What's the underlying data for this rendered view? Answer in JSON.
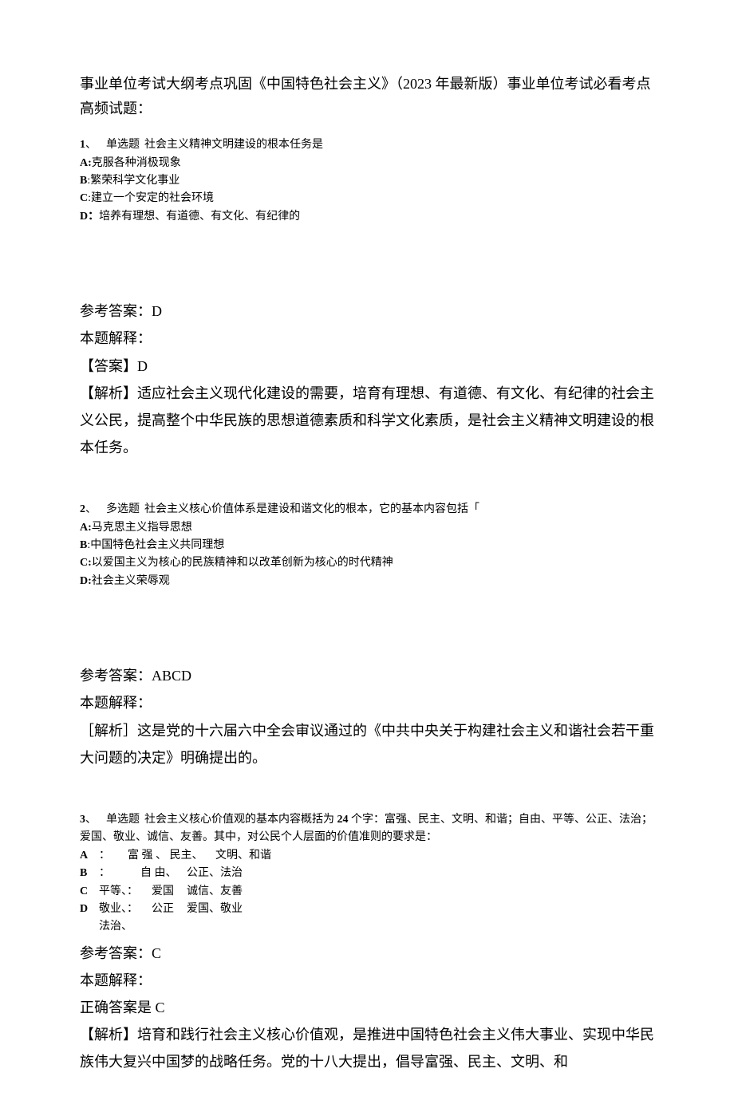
{
  "title": "事业单位考试大纲考点巩固《中国特色社会主义》（2023 年最新版）事业单位考试必看考点高频试题：",
  "q1": {
    "num": "1",
    "type": "单选题",
    "stem": "社会主义精神文明建设的根本任务是",
    "A_label": "A:",
    "A_text": "克服各种消极现象",
    "B_label": "B",
    "B_text": ":繁荣科学文化事业",
    "C_label": "C",
    "C_text": ":建立一个安定的社会环境",
    "D_label": "D：",
    "D_text": "培养有理想、有道德、有文化、有纪律的",
    "ref_answer_label": "参考答案：",
    "ref_answer": "D",
    "expl_label": "本题解释：",
    "ans_label": "【答案】",
    "ans": "D",
    "explain": "【解析】适应社会主义现代化建设的需要，培育有理想、有道德、有文化、有纪律的社会主义公民，提高整个中华民族的思想道德素质和科学文化素质，是社会主义精神文明建设的根本任务。"
  },
  "q2": {
    "num": "2",
    "type": "多选题",
    "stem": "社会主义核心价值体系是建设和谐文化的根本，它的基本内容包括「",
    "A_label": "A:",
    "A_text": "马克思主义指导思想",
    "B_label": "B",
    "B_text": ":中国特色社会主义共同理想",
    "C_label": "C:",
    "C_text": "以爱国主义为核心的民族精神和以改革创新为核心的时代精神",
    "D_label": "D:",
    "D_text": "社会主义荣辱观",
    "ref_answer_label": "参考答案：",
    "ref_answer": "ABCD",
    "expl_label": "本题解释：",
    "explain": "［解析］这是党的十六届六中全会审议通过的《中共中央关于构建社会主义和谐社会若干重大问题的决定》明确提出的。"
  },
  "q3": {
    "num": "3",
    "type": "单选题",
    "stem_a": "社会主义核心价值观的基本内容概括为 ",
    "stem_num": "24 ",
    "stem_b": "个字：富强、民主、文明、和谐；自由、平等、公正、法治；爱国、敬业、诚信、友善。其中，对公民个人层面的价值准则的要求是：",
    "optA": {
      "c1": "A",
      "c2": "：",
      "c3": "富 强 、 民主、",
      "c4": "文明、和谐"
    },
    "optB": {
      "c1": "B",
      "c2": "：",
      "c3": "自 由、",
      "c4": "公正、法治"
    },
    "optC": {
      "c1": "C",
      "c2": "平等、：",
      "c3": "爱国",
      "c4": "诚信、友善"
    },
    "optD": {
      "c1": "D",
      "c2": "敬业、：",
      "c3": "公正",
      "c4": "爱国、敬业"
    },
    "tail": "法治、",
    "ref_answer_label": "参考答案：",
    "ref_answer": "C",
    "expl_label": "本题解释：",
    "correct_label": "正确答案是 ",
    "correct": "C",
    "explain": "【解析】培育和践行社会主义核心价值观，是推进中国特色社会主义伟大事业、实现中华民族伟大复兴中国梦的战略任务。党的十八大提出，倡导富强、民主、文明、和"
  }
}
